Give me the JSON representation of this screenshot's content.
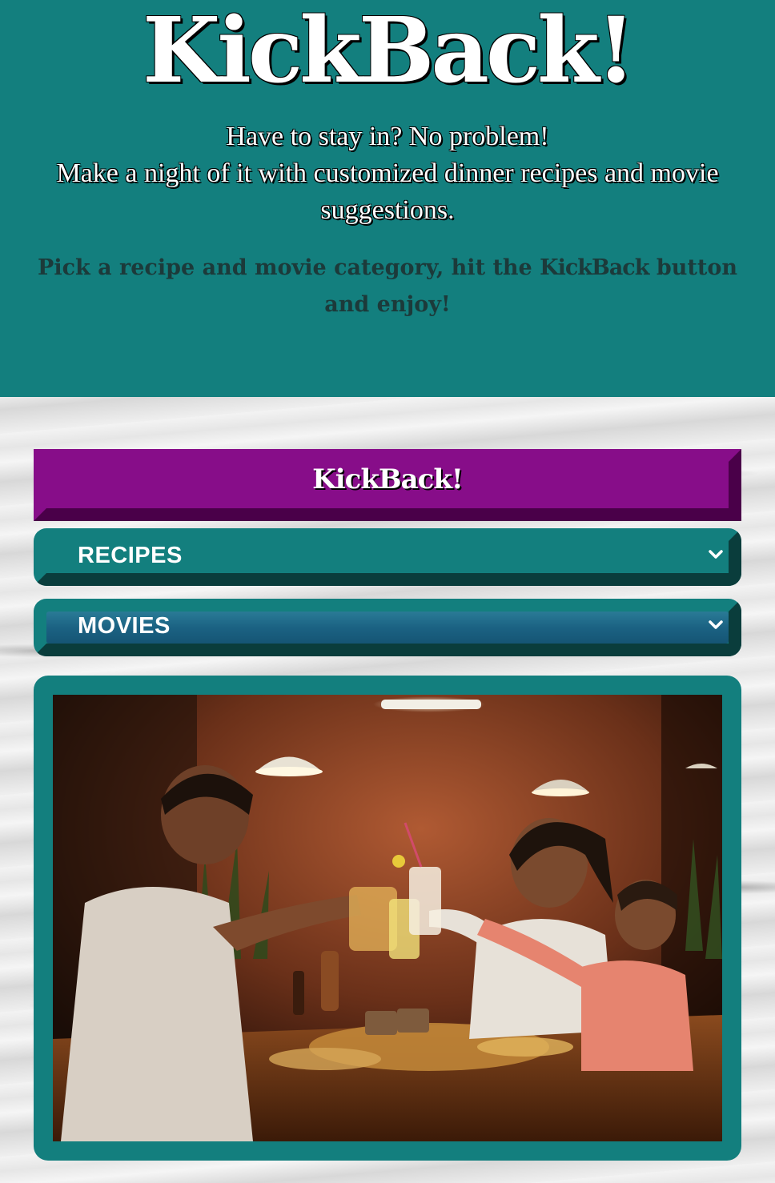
{
  "header": {
    "title": "KickBack!",
    "tagline_line1": "Have to stay in? No problem!",
    "tagline_line2": "Make a night of it with customized dinner recipes and movie suggestions.",
    "instructions_before": "Pick a recipe and movie category, hit the ",
    "instructions_brand": "KickBack",
    "instructions_after": " button and enjoy!"
  },
  "controls": {
    "kickback_button_label": "KickBack!",
    "recipes_select": {
      "selected": "RECIPES",
      "icon": "chevron-down-icon"
    },
    "movies_select": {
      "selected": "MOVIES",
      "icon": "chevron-down-icon"
    }
  },
  "photo": {
    "alt": "Family toasting drinks over pizza at a restaurant table"
  },
  "colors": {
    "header_bg": "#137f7e",
    "button_purple": "#870d89",
    "button_shadow": "#4a0049",
    "select_teal": "#137f7e",
    "select_shadow": "#0a3d3c"
  }
}
